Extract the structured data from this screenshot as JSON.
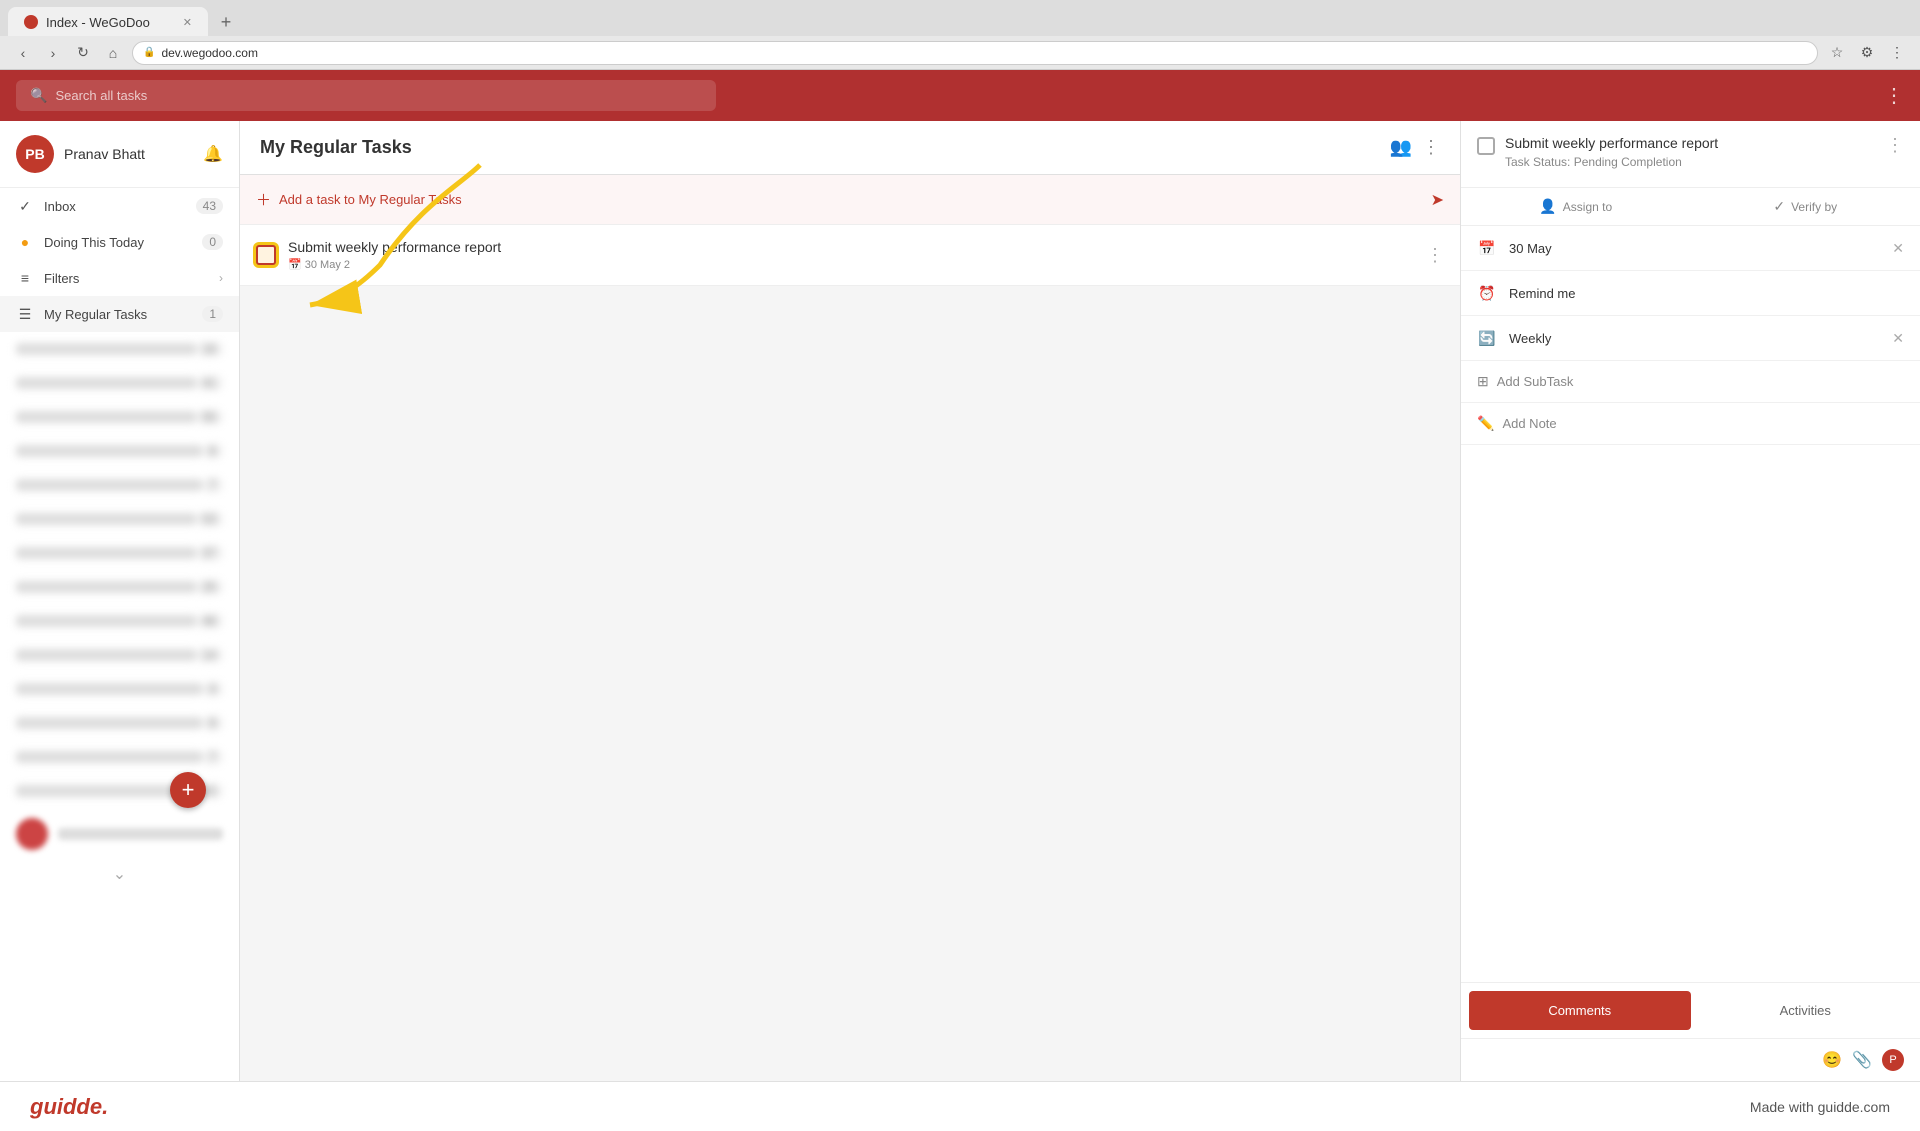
{
  "browser": {
    "tab_title": "Index - WeGoDoo",
    "tab_url": "dev.wegodoo.com"
  },
  "search": {
    "placeholder": "Search all tasks"
  },
  "sidebar": {
    "user": {
      "name": "Pranav Bhatt",
      "initials": "PB"
    },
    "items": [
      {
        "id": "inbox",
        "label": "Inbox",
        "count": "43",
        "icon": "✓"
      },
      {
        "id": "doing-today",
        "label": "Doing This Today",
        "count": "0",
        "icon": "●"
      },
      {
        "id": "filters",
        "label": "Filters",
        "count": "",
        "icon": "≡",
        "has_chevron": true
      },
      {
        "id": "my-regular-tasks",
        "label": "My Regular Tasks",
        "count": "1",
        "icon": "☰"
      }
    ],
    "blurred_items": [
      {
        "count": "16"
      },
      {
        "label": "rs",
        "count": "41"
      },
      {
        "count": "55"
      },
      {
        "count": "6"
      },
      {
        "count": "7"
      },
      {
        "count": "53"
      },
      {
        "count": "37"
      },
      {
        "count": "25"
      },
      {
        "label": "ce",
        "count": "46"
      },
      {
        "count": "14"
      },
      {
        "count": "4"
      },
      {
        "count": "6"
      },
      {
        "count": "7"
      },
      {
        "count": "15"
      }
    ]
  },
  "main": {
    "title": "My Regular Tasks",
    "add_task_placeholder": "Add a task to My Regular Tasks",
    "tasks": [
      {
        "id": 1,
        "title": "Submit weekly performance report",
        "date": "30 May 2",
        "checked": false
      }
    ]
  },
  "right_panel": {
    "task_title": "Submit weekly performance report",
    "task_status_label": "Task Status:",
    "task_status_value": "Pending Completion",
    "assign_to_label": "Assign to",
    "verify_by_label": "Verify by",
    "date_label": "30 May",
    "remind_label": "Remind me",
    "recur_label": "Weekly",
    "add_subtask_label": "Add SubTask",
    "add_note_label": "Add Note",
    "tabs": {
      "comments": "Comments",
      "activities": "Activities"
    },
    "footer_icons": [
      "emoji",
      "attachment",
      "profile"
    ]
  },
  "footer": {
    "logo": "guidde.",
    "made_with": "Made with guidde.com"
  }
}
